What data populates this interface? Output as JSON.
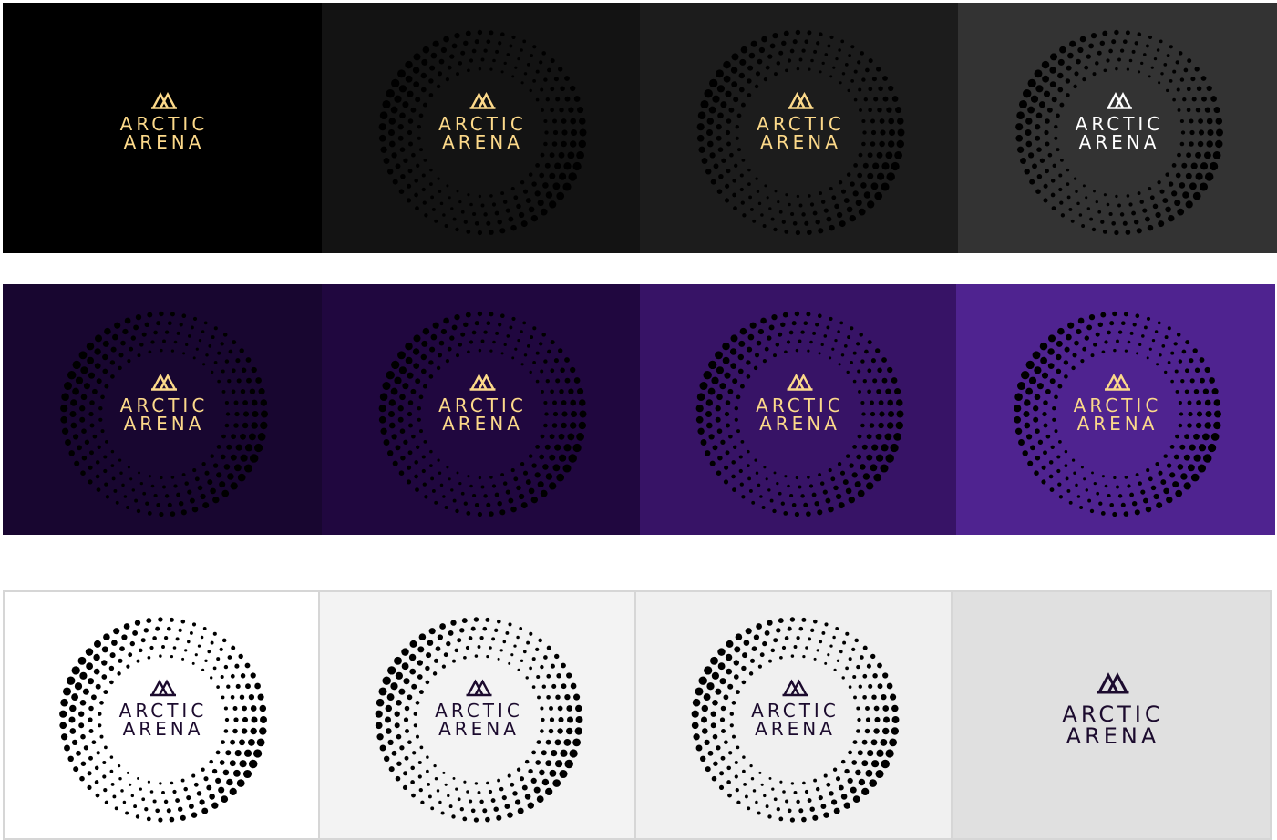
{
  "brand": {
    "line1": "ARCTIC",
    "line2": "ARENA"
  },
  "colors": {
    "gold": "#FFD166",
    "orange": "#FFA23A",
    "pink": "#E5367A",
    "gold_text": "#FCD98A",
    "white": "#FFFFFF",
    "navy": "#1C0B2E"
  },
  "rows": [
    {
      "name": "dark-row",
      "tiles": [
        {
          "bg": "#000000",
          "text": "#FCD98A",
          "mark": "#FCD98A",
          "rings": true,
          "fade": "#000000"
        },
        {
          "bg": "#131313",
          "text": "#FCD98A",
          "mark": "#FCD98A",
          "rings": true,
          "fade": "#131313"
        },
        {
          "bg": "#1C1C1C",
          "text": "#FCD98A",
          "mark": "#FCD98A",
          "rings": true,
          "fade": "#1C1C1C"
        },
        {
          "bg": "#333333",
          "text": "#FFFFFF",
          "mark": "#FFFFFF",
          "rings": true,
          "fade": "#333333"
        }
      ]
    },
    {
      "name": "purple-row",
      "tiles": [
        {
          "bg": "#180630",
          "text": "#FCD98A",
          "mark": "#FCD98A",
          "rings": true,
          "fade": "#180630"
        },
        {
          "bg": "#20073F",
          "text": "#FCD98A",
          "mark": "#FCD98A",
          "rings": true,
          "fade": "#20073F"
        },
        {
          "bg": "#371366",
          "text": "#FCD98A",
          "mark": "#FCD98A",
          "rings": true,
          "fade": "#371366"
        },
        {
          "bg": "#4F2390",
          "text": "#FCD98A",
          "mark": "#FCD98A",
          "rings": true,
          "fade": "#4F2390"
        }
      ]
    },
    {
      "name": "light-row",
      "tiles": [
        {
          "bg": "#FFFFFF",
          "text": "#1C0B2E",
          "mark": "#1C0B2E",
          "rings": true,
          "fade": "#FFFFFF"
        },
        {
          "bg": "#F3F3F3",
          "text": "#1C0B2E",
          "mark": "#1C0B2E",
          "rings": true,
          "fade": "#F3F3F3"
        },
        {
          "bg": "#F0F0F0",
          "text": "#1C0B2E",
          "mark": "#1C0B2E",
          "rings": true,
          "fade": "#F0F0F0"
        },
        {
          "bg": "#E0E0E0",
          "text": "#1C0B2E",
          "mark": "#1C0B2E",
          "rings": false,
          "fade": "#E0E0E0"
        }
      ]
    }
  ]
}
